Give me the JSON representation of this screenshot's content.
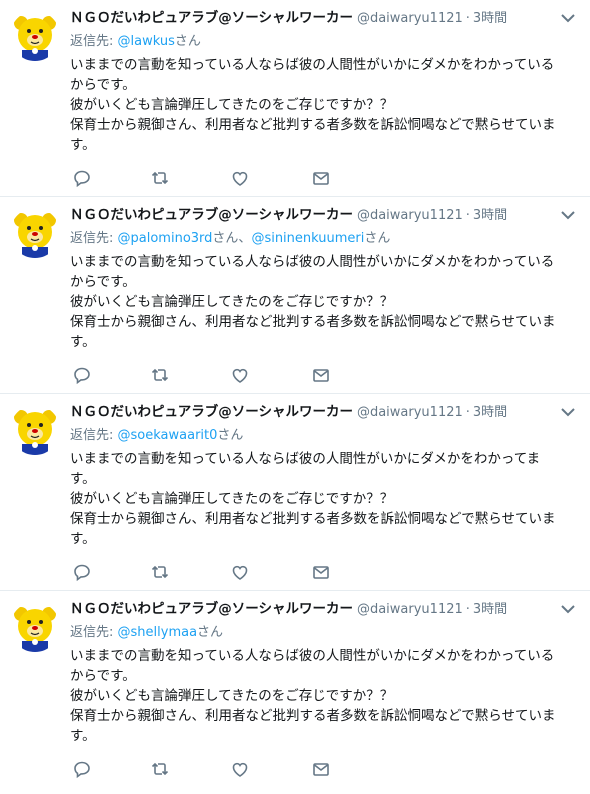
{
  "colors": {
    "link": "#1da1f2",
    "muted": "#657786",
    "text": "#14171a",
    "divider": "#e6ecf0"
  },
  "icons": [
    "reply-icon",
    "retweet-icon",
    "like-icon",
    "message-icon",
    "chevron-down-icon"
  ],
  "tweets": [
    {
      "name": "ＮＧＯだいわピュアラブ@ソーシャルワーカー",
      "handle": "@daiwaryu1121",
      "dot": "·",
      "time": "3時間",
      "reply_label": "返信先: ",
      "mentions": [
        "@lawkus",
        "",
        ""
      ],
      "mention_suffix": [
        "さん",
        "",
        ""
      ],
      "lines": [
        "いままでの言動を知っている人ならば彼の人間性がいかにダメかをわかっている",
        "からです。",
        "彼がいくども言論弾圧してきたのをご存じですか？？",
        "保育士から親御さん、利用者など批判する者多数を訴訟恫喝などで黙らせていま",
        "す。"
      ]
    },
    {
      "name": "ＮＧＯだいわピュアラブ@ソーシャルワーカー",
      "handle": "@daiwaryu1121",
      "dot": "·",
      "time": "3時間",
      "reply_label": "返信先: ",
      "mentions": [
        "@palomino3rd",
        "@sininenkuumeri",
        ""
      ],
      "mention_suffix": [
        "さん、",
        "さん",
        ""
      ],
      "lines": [
        "いままでの言動を知っている人ならば彼の人間性がいかにダメかをわかっている",
        "からです。",
        "彼がいくども言論弾圧してきたのをご存じですか？？",
        "保育士から親御さん、利用者など批判する者多数を訴訟恫喝などで黙らせていま",
        "す。"
      ]
    },
    {
      "name": "ＮＧＯだいわピュアラブ@ソーシャルワーカー",
      "handle": "@daiwaryu1121",
      "dot": "·",
      "time": "3時間",
      "reply_label": "返信先: ",
      "mentions": [
        "@soekawaarit0",
        "",
        ""
      ],
      "mention_suffix": [
        "さん",
        "",
        ""
      ],
      "lines": [
        "いままでの言動を知っている人ならば彼の人間性がいかにダメかをわかってま",
        "す。",
        "彼がいくども言論弾圧してきたのをご存じですか？？",
        "保育士から親御さん、利用者など批判する者多数を訴訟恫喝などで黙らせていま",
        "す。"
      ]
    },
    {
      "name": "ＮＧＯだいわピュアラブ@ソーシャルワーカー",
      "handle": "@daiwaryu1121",
      "dot": "·",
      "time": "3時間",
      "reply_label": "返信先: ",
      "mentions": [
        "@shellymaa",
        "",
        ""
      ],
      "mention_suffix": [
        "さん",
        "",
        ""
      ],
      "lines": [
        "いままでの言動を知っている人ならば彼の人間性がいかにダメかをわかっている",
        "からです。",
        "彼がいくども言論弾圧してきたのをご存じですか？？",
        "保育士から親御さん、利用者など批判する者多数を訴訟恫喝などで黙らせていま",
        "す。"
      ]
    }
  ]
}
